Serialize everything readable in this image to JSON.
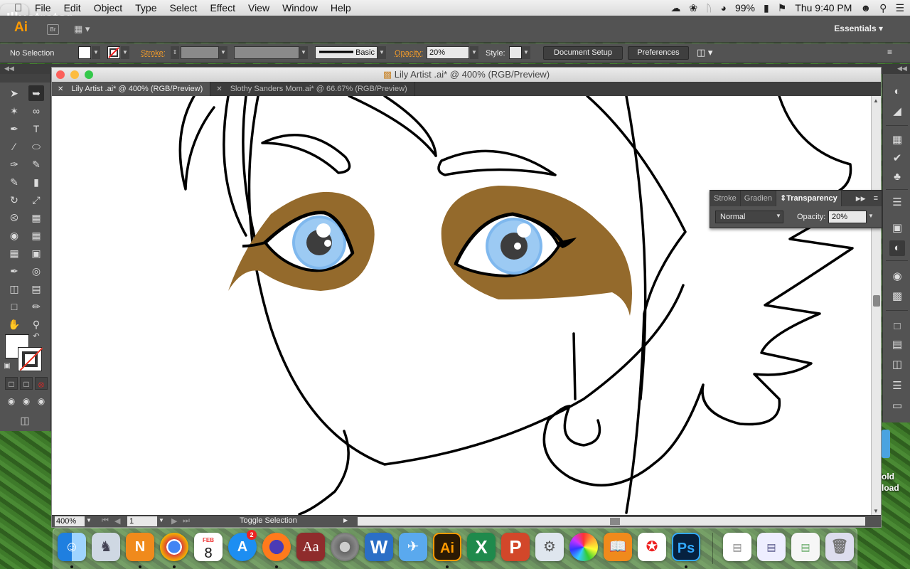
{
  "menubar": {
    "app_name": "Illustrator",
    "menus": [
      "File",
      "Edit",
      "Object",
      "Type",
      "Select",
      "Effect",
      "View",
      "Window",
      "Help"
    ],
    "battery": "99%",
    "clock": "Thu 9:40 PM"
  },
  "appbar": {
    "logo": "Ai",
    "bridge": "Br",
    "workspace": "Essentials"
  },
  "controlbar": {
    "selection": "No Selection",
    "stroke_label": "Stroke:",
    "brush_label": "Basic",
    "opacity_label": "Opacity:",
    "opacity_value": "20%",
    "style_label": "Style:",
    "document_setup": "Document Setup",
    "preferences": "Preferences"
  },
  "document": {
    "window_title": "Lily Artist .ai* @ 400% (RGB/Preview)",
    "tabs": [
      {
        "label": "Lily Artist .ai* @ 400% (RGB/Preview)"
      },
      {
        "label": "Slothy Sanders Mom.ai* @ 66.67% (RGB/Preview)"
      }
    ],
    "zoom": "400%",
    "page": "1",
    "status": "Toggle Selection"
  },
  "transparency_panel": {
    "tabs": [
      "Stroke",
      "Gradien",
      "Transparency"
    ],
    "blend_mode": "Normal",
    "opacity_label": "Opacity:",
    "opacity_value": "20%"
  },
  "artwork": {
    "eyeshadow_color": "#946a2c",
    "iris_color": "#7fb8ee",
    "outline_color": "#000000"
  },
  "desktop": {
    "text_line1": "old",
    "text_line2": "load"
  },
  "dock": {
    "calendar_month": "FEB",
    "calendar_day": "8",
    "appstore_badge": "2",
    "apps": [
      "Finder",
      "Preview",
      "Notability",
      "Chrome",
      "Calendar",
      "App Store",
      "Firefox",
      "Dictionary",
      "System Preferences",
      "Word",
      "Mail",
      "Illustrator",
      "Excel",
      "PowerPoint",
      "Image Capture",
      "Photos",
      "iBooks",
      "Acrobat",
      "Photoshop"
    ]
  }
}
